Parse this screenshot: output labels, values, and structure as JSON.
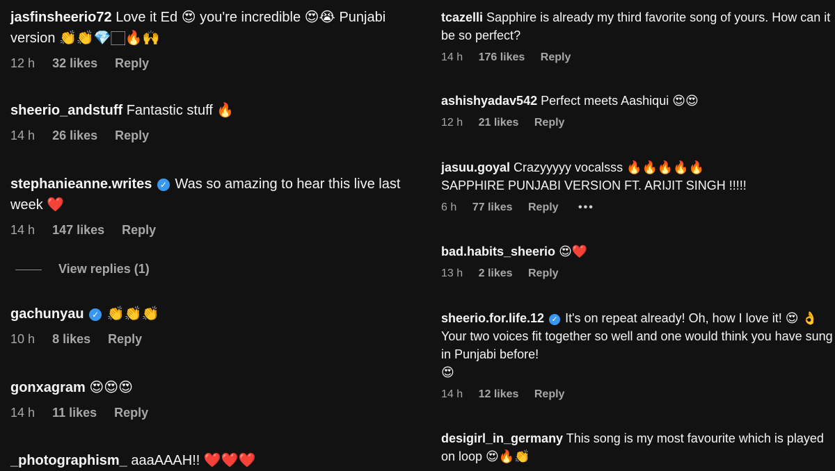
{
  "left_comments": [
    {
      "username": "jasfinsheerio72",
      "verified": false,
      "text": "Love it Ed 😍 you're incredible 😍😭 Punjabi version 👏👏💎🏻🔥🙌",
      "time": "12 h",
      "likes": "32 likes",
      "reply": "Reply"
    },
    {
      "username": "sheerio_andstuff",
      "verified": false,
      "text": "Fantastic stuff 🔥",
      "time": "14 h",
      "likes": "26 likes",
      "reply": "Reply"
    },
    {
      "username": "stephanieanne.writes",
      "verified": true,
      "text": "Was so amazing to hear this live last week ❤️",
      "time": "14 h",
      "likes": "147 likes",
      "reply": "Reply",
      "view_replies": "View replies (1)"
    },
    {
      "username": "gachunyau",
      "verified": true,
      "text": "👏👏👏",
      "time": "10 h",
      "likes": "8 likes",
      "reply": "Reply"
    },
    {
      "username": "gonxagram",
      "verified": false,
      "text": "😍😍😍",
      "time": "14 h",
      "likes": "11 likes",
      "reply": "Reply"
    },
    {
      "username": "_photographism_",
      "verified": false,
      "text": "aaaAAAH!! ❤️❤️❤️"
    }
  ],
  "right_comments": [
    {
      "username": "tcazelli",
      "verified": false,
      "text": "Sapphire is already my third favorite song of yours. How can it be so perfect?",
      "time": "14 h",
      "likes": "176 likes",
      "reply": "Reply"
    },
    {
      "username": "ashishyadav542",
      "verified": false,
      "text": "Perfect meets Aashiqui 😍😍",
      "time": "12 h",
      "likes": "21 likes",
      "reply": "Reply"
    },
    {
      "username": "jasuu.goyal",
      "verified": false,
      "text": "Crazyyyyy vocalsss 🔥🔥🔥🔥🔥",
      "text_line2": "SAPPHIRE PUNJABI VERSION FT. ARIJIT SINGH !!!!!",
      "time": "6 h",
      "likes": "77 likes",
      "reply": "Reply",
      "more": "•••"
    },
    {
      "username": "bad.habits_sheerio",
      "verified": false,
      "text": "😍❤️",
      "time": "13 h",
      "likes": "2 likes",
      "reply": "Reply"
    },
    {
      "username": "sheerio.for.life.12",
      "verified": true,
      "text": "It's on repeat already! Oh, how I love it! 😍 👌 Your two voices fit together so well and one would think you have sung in Punjabi before!",
      "text_line2": "😍",
      "time": "14 h",
      "likes": "12 likes",
      "reply": "Reply"
    },
    {
      "username": "desigirl_in_germany",
      "verified": false,
      "text": "This song is my most favourite which is played on loop 😍🔥👏"
    }
  ],
  "icons": {
    "verified": "verified-badge-icon",
    "verified_glyph": "✓",
    "more": "more-options-icon"
  },
  "colors": {
    "background": "#121212",
    "text": "#f5f5f5",
    "meta": "#a8a8a8",
    "verified": "#3897f0"
  }
}
